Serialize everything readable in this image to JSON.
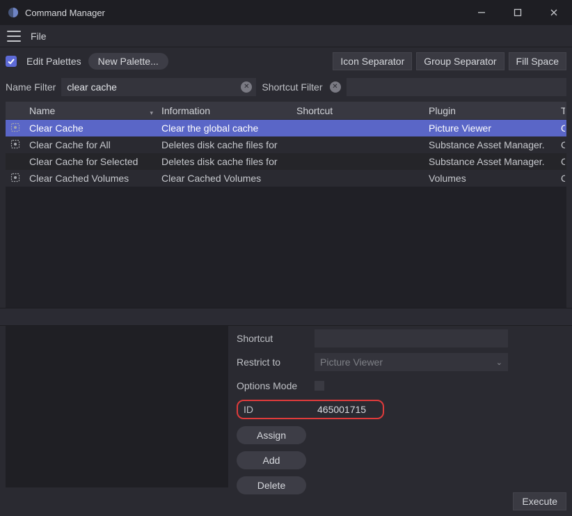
{
  "window": {
    "title": "Command Manager"
  },
  "menu": {
    "file": "File"
  },
  "toolbar": {
    "edit_palettes_label": "Edit Palettes",
    "new_palette_label": "New Palette...",
    "icon_separator_label": "Icon Separator",
    "group_separator_label": "Group Separator",
    "fill_space_label": "Fill Space"
  },
  "filters": {
    "name_label": "Name Filter",
    "name_value": "clear cache",
    "shortcut_label": "Shortcut Filter"
  },
  "table": {
    "headers": {
      "name": "Name",
      "info": "Information",
      "shortcut": "Shortcut",
      "plugin": "Plugin",
      "t": "T"
    },
    "rows": [
      {
        "name": "Clear Cache",
        "info": "Clear the global cache",
        "shortcut": "",
        "plugin": "Picture Viewer",
        "t": "C",
        "selected": true,
        "icon": true
      },
      {
        "name": "Clear Cache for All",
        "info": "Deletes disk cache files for",
        "shortcut": "",
        "plugin": "Substance Asset Manager.",
        "t": "C",
        "selected": false,
        "icon": true
      },
      {
        "name": "Clear Cache for Selected",
        "info": "Deletes disk cache files for",
        "shortcut": "",
        "plugin": "Substance Asset Manager.",
        "t": "C",
        "selected": false,
        "icon": false
      },
      {
        "name": "Clear Cached Volumes",
        "info": "Clear Cached Volumes",
        "shortcut": "",
        "plugin": "Volumes",
        "t": "C",
        "selected": false,
        "icon": true
      }
    ]
  },
  "details": {
    "shortcut_label": "Shortcut",
    "restrict_label": "Restrict to",
    "restrict_value": "Picture Viewer",
    "options_label": "Options Mode",
    "id_label": "ID",
    "id_value": "465001715",
    "assign_label": "Assign",
    "add_label": "Add",
    "delete_label": "Delete",
    "execute_label": "Execute"
  }
}
